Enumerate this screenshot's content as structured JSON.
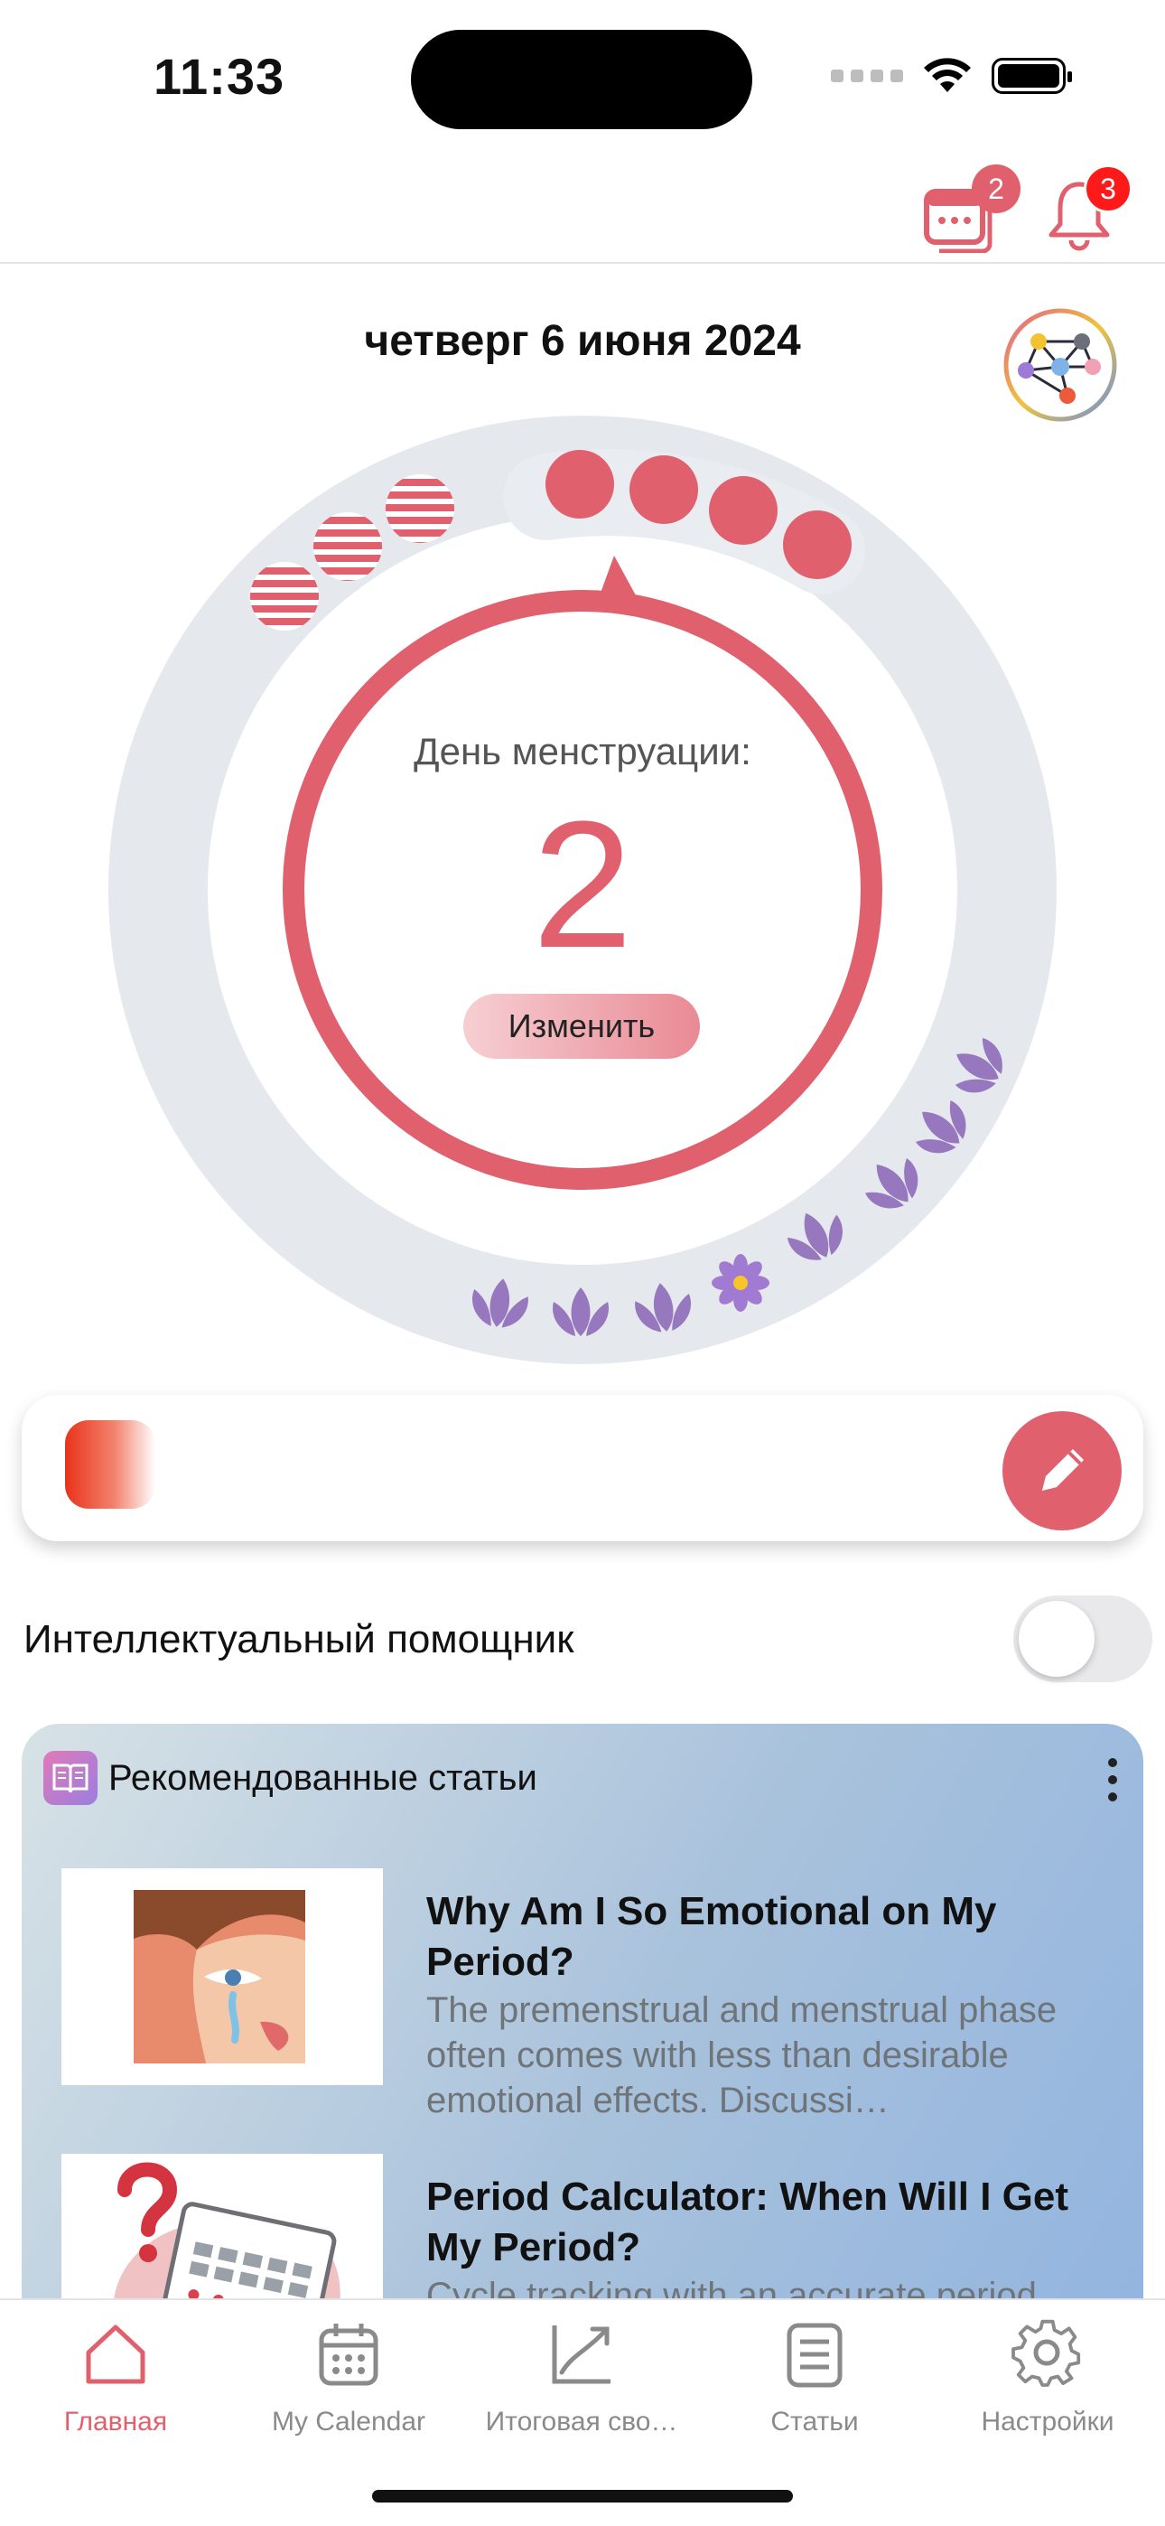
{
  "status_bar": {
    "time": "11:33"
  },
  "top_bar": {
    "calendar_badge": "2",
    "notifications_badge": "3"
  },
  "header": {
    "date": "четверг 6 июня 2024"
  },
  "cycle": {
    "label": "День менструации:",
    "day": "2",
    "change_button": "Изменить",
    "accent_color": "#e0606e",
    "fertile_color": "#8e6bb8"
  },
  "assistant": {
    "label": "Интеллектуальный помощник",
    "enabled": false
  },
  "articles": {
    "title": "Рекомендованные статьи",
    "items": [
      {
        "title": "Why Am I So Emotional on My Period?",
        "desc": "The premenstrual and menstrual phase often comes with less than desirable emotional effects. Discussi…"
      },
      {
        "title": "Period Calculator: When Will I Get My Period?",
        "desc": "Cycle tracking with an accurate period"
      }
    ]
  },
  "tabs": [
    {
      "label": "Главная",
      "icon": "home-icon",
      "active": true
    },
    {
      "label": "My Calendar",
      "icon": "calendar-icon",
      "active": false
    },
    {
      "label": "Итоговая сво…",
      "icon": "chart-icon",
      "active": false
    },
    {
      "label": "Статьи",
      "icon": "articles-icon",
      "active": false
    },
    {
      "label": "Настройки",
      "icon": "settings-icon",
      "active": false
    }
  ]
}
